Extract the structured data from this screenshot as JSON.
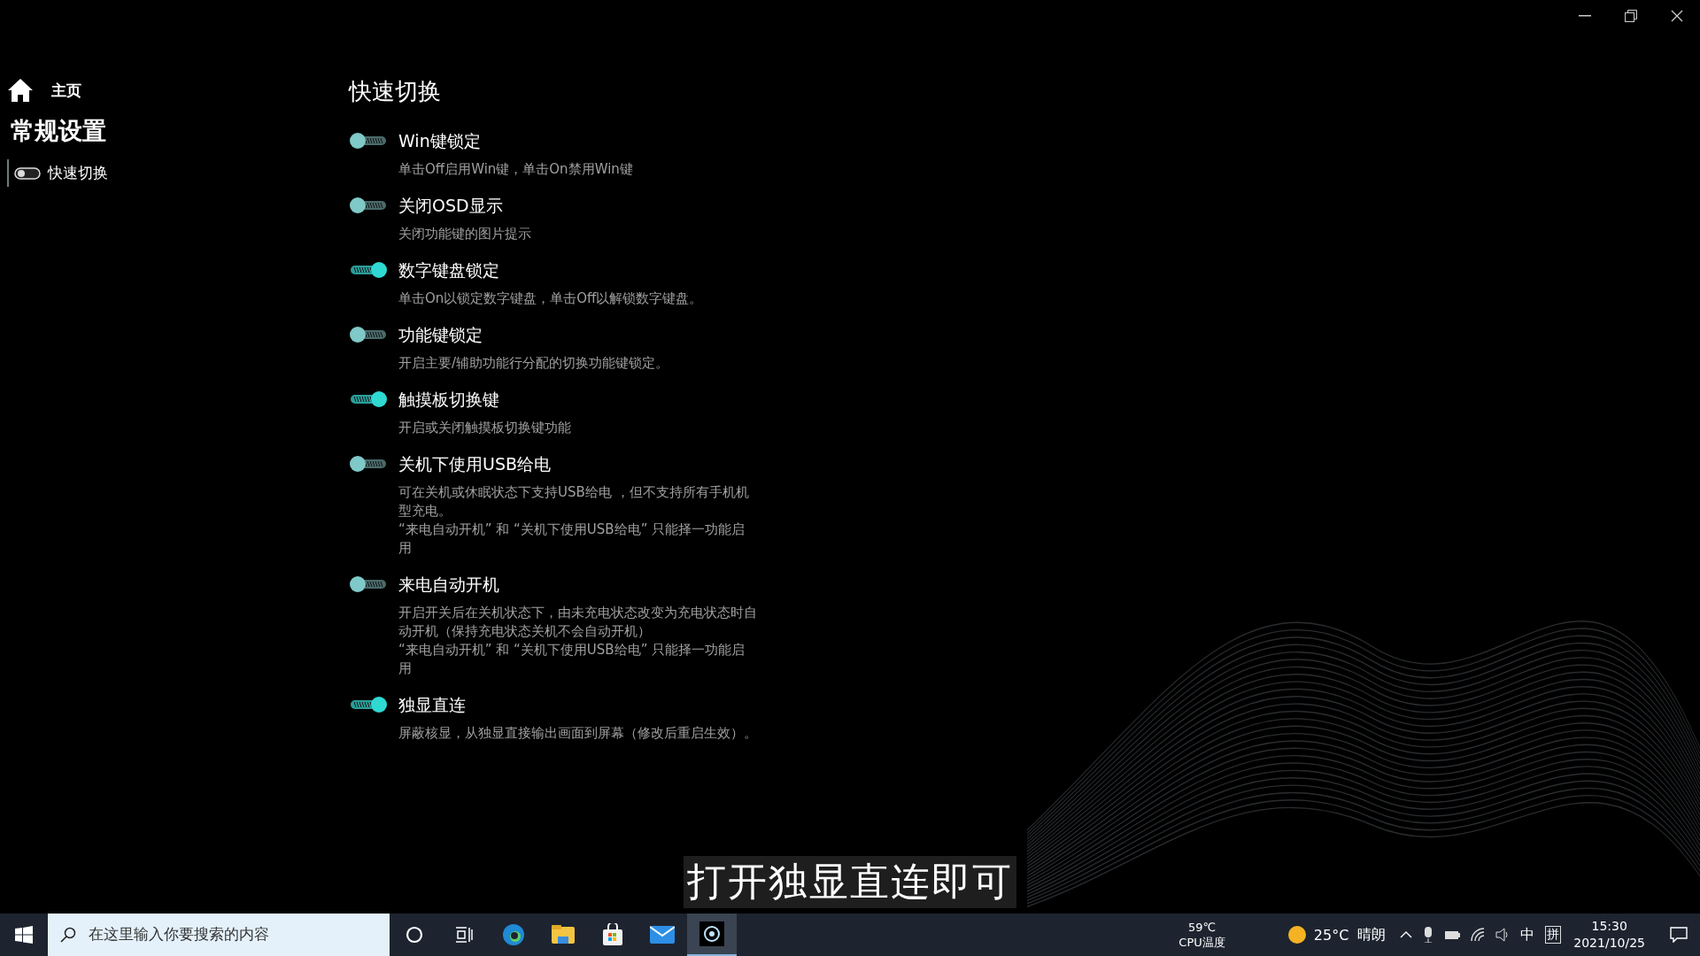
{
  "sidebar": {
    "home": "主页",
    "section": "常规设置",
    "items": [
      {
        "label": "快速切换",
        "selected": true
      }
    ]
  },
  "page_title": "快速切换",
  "settings": [
    {
      "title": "Win键锁定",
      "on": false,
      "description": [
        "单击Off启用Win键，单击On禁用Win键"
      ]
    },
    {
      "title": "关闭OSD显示",
      "on": false,
      "description": [
        "关闭功能键的图片提示"
      ]
    },
    {
      "title": "数字键盘锁定",
      "on": true,
      "description": [
        "单击On以锁定数字键盘，单击Off以解锁数字键盘。"
      ]
    },
    {
      "title": "功能键锁定",
      "on": false,
      "description": [
        "开启主要/辅助功能行分配的切换功能键锁定。"
      ]
    },
    {
      "title": "触摸板切换键",
      "on": true,
      "description": [
        "开启或关闭触摸板切换键功能"
      ]
    },
    {
      "title": "关机下使用USB给电",
      "on": false,
      "description": [
        "可在关机或休眠状态下支持USB给电 ，但不支持所有手机机型充电。",
        "“来电自动开机” 和 “关机下使用USB给电” 只能择一功能启用"
      ]
    },
    {
      "title": "来电自动开机",
      "on": false,
      "description": [
        "开启开关后在关机状态下，由未充电状态改变为充电状态时自动开机（保持充电状态关机不会自动开机）",
        "“来电自动开机” 和 “关机下使用USB给电” 只能择一功能启用"
      ]
    },
    {
      "title": "独显直连",
      "on": true,
      "description": [
        "屏蔽核显，从独显直接输出画面到屏幕（修改后重启生效）。"
      ]
    }
  ],
  "caption": "打开独显直连即可",
  "taskbar": {
    "search_placeholder": "在这里输入你要搜索的内容",
    "cpu_temp": "59℃",
    "cpu_label": "CPU温度",
    "weather_temp": "25°C",
    "weather": "晴朗",
    "ime": "中",
    "ime_mode": "拼",
    "time": "15:30",
    "date": "2021/10/25"
  }
}
